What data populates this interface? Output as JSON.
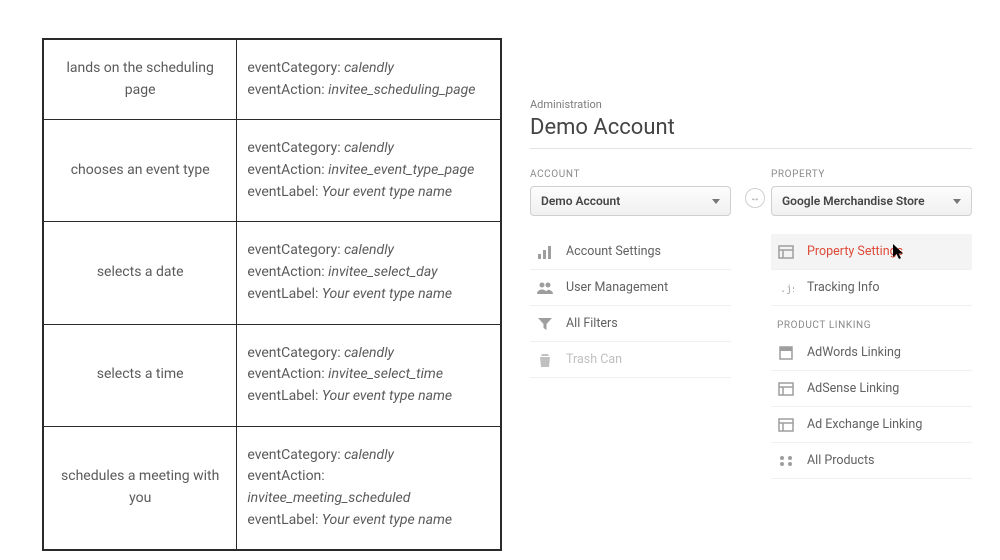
{
  "events": [
    {
      "action": "lands on the scheduling page",
      "category_label": "eventCategory:",
      "category_value": "calendly",
      "action_label": "eventAction:",
      "action_value": "invitee_scheduling_page",
      "label_label": null,
      "label_value": null
    },
    {
      "action": "chooses an event type",
      "category_label": "eventCategory:",
      "category_value": "calendly",
      "action_label": "eventAction:",
      "action_value": "invitee_event_type_page",
      "label_label": "eventLabel:",
      "label_value": "Your event type name"
    },
    {
      "action": "selects a date",
      "category_label": "eventCategory:",
      "category_value": "calendly",
      "action_label": "eventAction:",
      "action_value": "invitee_select_day",
      "label_label": "eventLabel:",
      "label_value": "Your event type name"
    },
    {
      "action": "selects a time",
      "category_label": "eventCategory:",
      "category_value": "calendly",
      "action_label": "eventAction:",
      "action_value": "invitee_select_time",
      "label_label": "eventLabel:",
      "label_value": "Your event type name"
    },
    {
      "action": "schedules a meeting with you",
      "category_label": "eventCategory:",
      "category_value": "calendly",
      "action_label": "eventAction:",
      "action_value": "invitee_meeting_scheduled",
      "label_label": "eventLabel:",
      "label_value": "Your event type name"
    }
  ],
  "admin": {
    "label": "Administration",
    "title": "Demo Account",
    "connector": "↔",
    "account": {
      "header": "ACCOUNT",
      "select": "Demo Account",
      "items": [
        {
          "label": "Account Settings",
          "icon": "bars"
        },
        {
          "label": "User Management",
          "icon": "users"
        },
        {
          "label": "All Filters",
          "icon": "funnel"
        },
        {
          "label": "Trash Can",
          "icon": "trash",
          "disabled": true
        }
      ]
    },
    "property": {
      "header": "PROPERTY",
      "select": "Google Merchandise Store",
      "items_top": [
        {
          "label": "Property Settings",
          "icon": "layout",
          "active": true
        },
        {
          "label": "Tracking Info",
          "icon": "js"
        }
      ],
      "section": "PRODUCT LINKING",
      "items_bottom": [
        {
          "label": "AdWords Linking",
          "icon": "square"
        },
        {
          "label": "AdSense Linking",
          "icon": "layout"
        },
        {
          "label": "Ad Exchange Linking",
          "icon": "layout"
        },
        {
          "label": "All Products",
          "icon": "grid"
        }
      ]
    }
  }
}
